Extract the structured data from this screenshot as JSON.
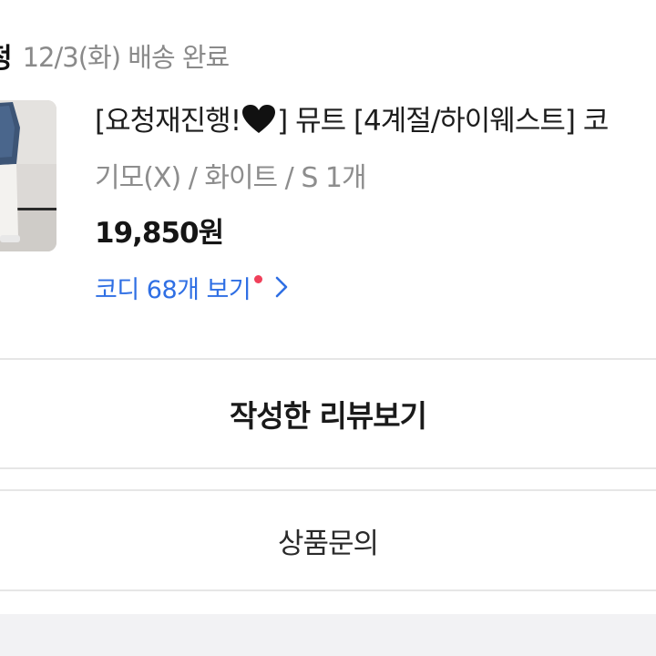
{
  "status": {
    "title": "정",
    "date_status": "12/3(화) 배송 완료"
  },
  "product": {
    "thumbnail_icon": "product-photo",
    "name_before_heart": "[요청재진행!",
    "heart_icon": "black-heart-icon",
    "name_after_heart": "] 뮤트 [4계절/하이웨스트] 코",
    "options": "기모(X) / 화이트 / S 1개",
    "price": "19,850원",
    "coordi_link_label": "코디 68개 보기",
    "coordi_link_icon": "chevron-right-icon",
    "new_badge_color": "#f0405a"
  },
  "actions": {
    "review_button_label": "작성한 리뷰보기",
    "inquiry_button_label": "상품문의"
  },
  "colors": {
    "link": "#2f6fe4",
    "muted_text": "#8d8d8d",
    "divider": "#e6e6e6"
  }
}
